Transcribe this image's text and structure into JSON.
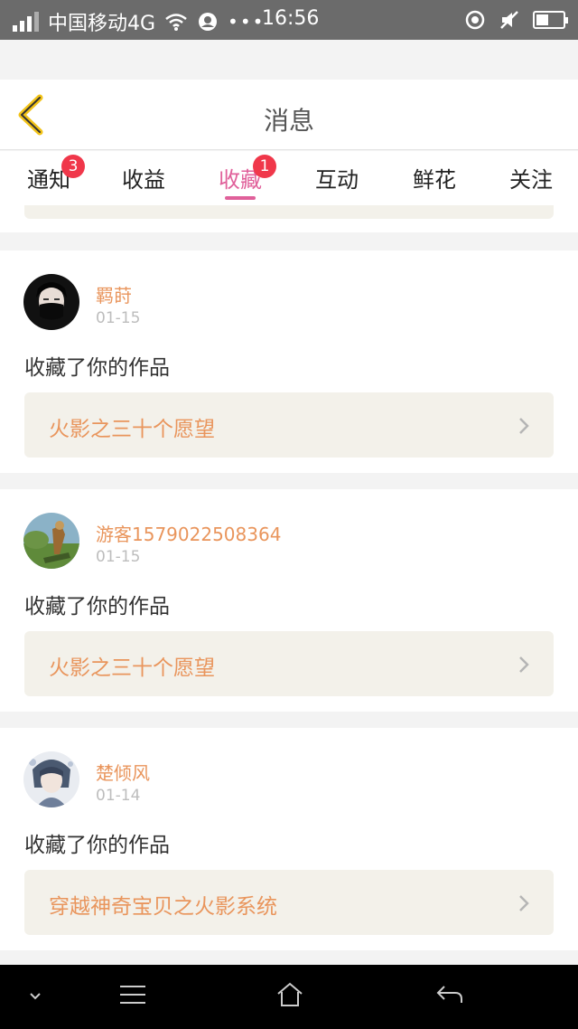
{
  "status_bar": {
    "carrier": "中国移动4G",
    "time": "16:56",
    "battery_level": 0.45
  },
  "header": {
    "title": "消息",
    "back_icon": "chevron-left-icon"
  },
  "tabs": [
    {
      "label": "通知",
      "badge": "3",
      "active": false
    },
    {
      "label": "收益",
      "badge": "",
      "active": false
    },
    {
      "label": "收藏",
      "badge": "1",
      "active": true
    },
    {
      "label": "互动",
      "badge": "",
      "active": false
    },
    {
      "label": "鲜花",
      "badge": "",
      "active": false
    },
    {
      "label": "关注",
      "badge": "",
      "active": false
    }
  ],
  "messages": [
    {
      "username": "羁莳",
      "date": "01-15",
      "action": "收藏了你的作品",
      "work": "火影之三十个愿望"
    },
    {
      "username": "游客1579022508364",
      "date": "01-15",
      "action": "收藏了你的作品",
      "work": "火影之三十个愿望"
    },
    {
      "username": "楚倾风",
      "date": "01-14",
      "action": "收藏了你的作品",
      "work": "穿越神奇宝贝之火影系统"
    }
  ],
  "colors": {
    "accent": "#e0609a",
    "orange": "#e9955c",
    "badge": "#f0374a",
    "back_icon": "#f2c318"
  }
}
